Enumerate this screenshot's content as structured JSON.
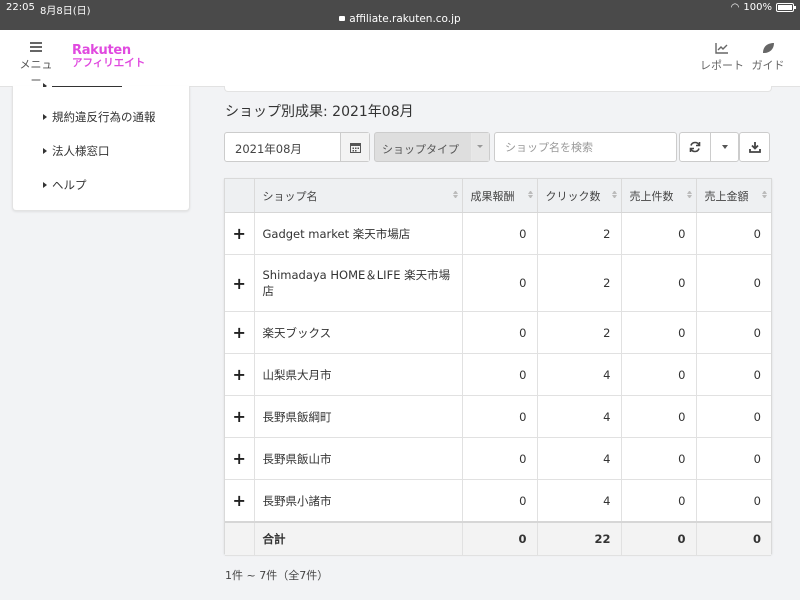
{
  "status_bar": {
    "time": "22:05",
    "date": "8月8日(日)",
    "url": "affiliate.rakuten.co.jp",
    "battery": "100%"
  },
  "header": {
    "menu_label": "メニュー",
    "logo_line1": "Rakuten",
    "logo_line2": "アフィリエイト",
    "report_label": "レポート",
    "guide_label": "ガイド"
  },
  "sidebar": {
    "items": [
      {
        "label": "規約違反行為の通報"
      },
      {
        "label": "法人様窓口"
      },
      {
        "label": "ヘルプ"
      }
    ]
  },
  "main": {
    "title": "ショップ別成果: 2021年08月",
    "date_value": "2021年08月",
    "shop_type_label": "ショップタイプ",
    "search_placeholder": "ショップ名を検索"
  },
  "table": {
    "columns": [
      "ショップ名",
      "成果報酬",
      "クリック数",
      "売上件数",
      "売上金額"
    ],
    "rows": [
      {
        "shop": "Gadget market 楽天市場店",
        "reward": "0",
        "clicks": "2",
        "sales_count": "0",
        "sales_amount": "0"
      },
      {
        "shop": "Shimadaya HOME＆LIFE 楽天市場店",
        "reward": "0",
        "clicks": "2",
        "sales_count": "0",
        "sales_amount": "0"
      },
      {
        "shop": "楽天ブックス",
        "reward": "0",
        "clicks": "2",
        "sales_count": "0",
        "sales_amount": "0"
      },
      {
        "shop": "山梨県大月市",
        "reward": "0",
        "clicks": "4",
        "sales_count": "0",
        "sales_amount": "0"
      },
      {
        "shop": "長野県飯綱町",
        "reward": "0",
        "clicks": "4",
        "sales_count": "0",
        "sales_amount": "0"
      },
      {
        "shop": "長野県飯山市",
        "reward": "0",
        "clicks": "4",
        "sales_count": "0",
        "sales_amount": "0"
      },
      {
        "shop": "長野県小諸市",
        "reward": "0",
        "clicks": "4",
        "sales_count": "0",
        "sales_amount": "0"
      }
    ],
    "total": {
      "label": "合計",
      "reward": "0",
      "clicks": "22",
      "sales_count": "0",
      "sales_amount": "0"
    },
    "expand_symbol": "+"
  },
  "pager": {
    "info": "1件 ~ 7件（全7件）"
  }
}
